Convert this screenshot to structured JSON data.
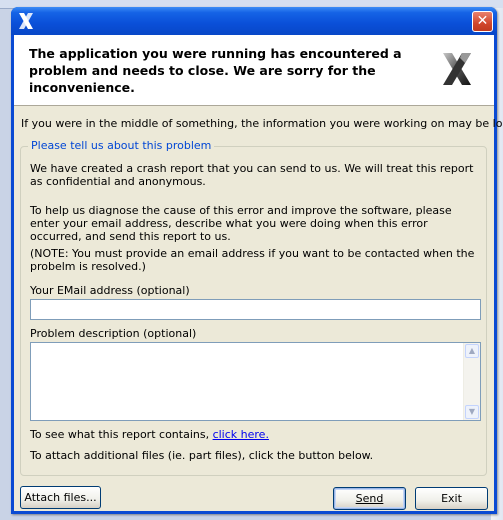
{
  "window": {
    "title_icon": "app-logo-icon",
    "close_glyph": "✕"
  },
  "header": {
    "message": "The application you were running has encountered a problem and needs to close.  We are sorry for the inconvenience."
  },
  "intro_text": "If you were in the middle of something, the information you were working on may be lost.",
  "group": {
    "legend": "Please tell us about this problem",
    "para1": "We have created a crash report that you can send to us.  We will treat this report as confidential and anonymous.",
    "para2": "To help us diagnose the cause of this error and improve the software, please enter your email address, describe what you were doing when this error occurred, and send this report to us.",
    "para3": "(NOTE: You must provide an email address if you want to be contacted when the probelm is resolved.)",
    "email_label": "Your EMail address (optional)",
    "email_value": "",
    "description_label": "Problem description (optional)",
    "description_value": "",
    "see_report_prefix": "To see what this report contains,",
    "see_report_link": "click here.",
    "attach_text": "To attach additional files (ie. part files), click the button below."
  },
  "buttons": {
    "attach": "Attach files...",
    "send": "Send",
    "exit": "Exit"
  },
  "colors": {
    "titlebar": "#0a4fd8",
    "dialog_bg": "#ece9d8",
    "group_legend": "#0046d5",
    "link": "#0000ee"
  }
}
